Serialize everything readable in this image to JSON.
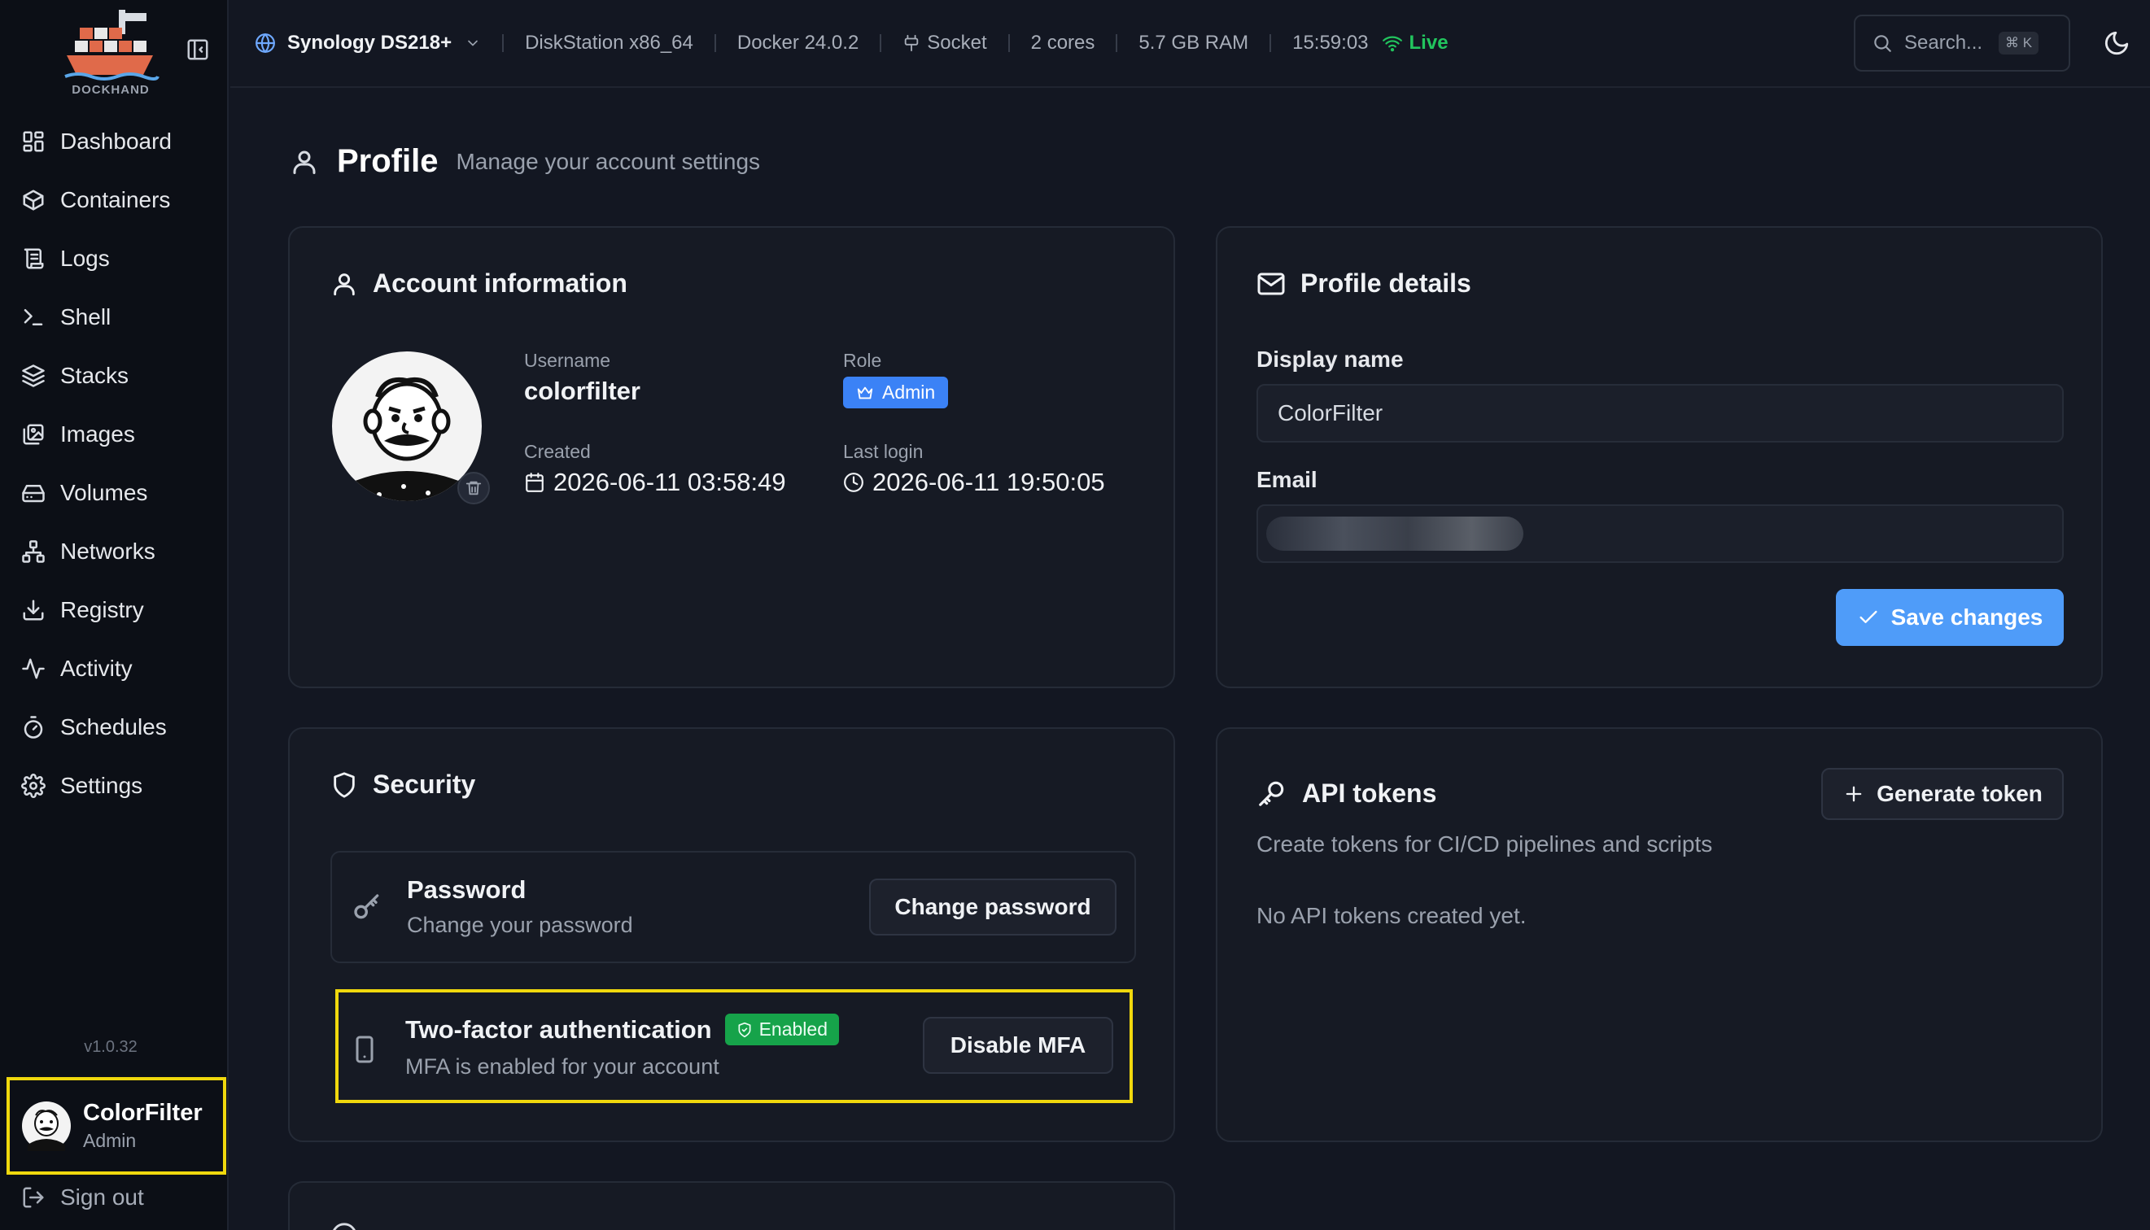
{
  "app": {
    "logo_text": "DOCKHAND",
    "version": "v1.0.32"
  },
  "sidebar": {
    "items": [
      {
        "label": "Dashboard",
        "icon": "dashboard-icon"
      },
      {
        "label": "Containers",
        "icon": "box-icon"
      },
      {
        "label": "Logs",
        "icon": "scroll-icon"
      },
      {
        "label": "Shell",
        "icon": "terminal-icon"
      },
      {
        "label": "Stacks",
        "icon": "layers-icon"
      },
      {
        "label": "Images",
        "icon": "images-icon"
      },
      {
        "label": "Volumes",
        "icon": "hard-drive-icon"
      },
      {
        "label": "Networks",
        "icon": "network-icon"
      },
      {
        "label": "Registry",
        "icon": "download-icon"
      },
      {
        "label": "Activity",
        "icon": "activity-icon"
      },
      {
        "label": "Schedules",
        "icon": "timer-icon"
      },
      {
        "label": "Settings",
        "icon": "gear-icon"
      }
    ],
    "user": {
      "name": "ColorFilter",
      "role": "Admin"
    },
    "signout_label": "Sign out"
  },
  "topbar": {
    "environment": "Synology DS218+",
    "host": "DiskStation x86_64",
    "docker": "Docker 24.0.2",
    "connection": "Socket",
    "cores": "2 cores",
    "ram": "5.7 GB RAM",
    "time": "15:59:03",
    "status": "Live",
    "search_placeholder": "Search...",
    "search_shortcut": "⌘ K"
  },
  "page": {
    "title": "Profile",
    "subtitle": "Manage your account settings"
  },
  "account": {
    "title": "Account information",
    "username_label": "Username",
    "username": "colorfilter",
    "role_label": "Role",
    "role": "Admin",
    "created_label": "Created",
    "created": "2026-06-11 03:58:49",
    "last_login_label": "Last login",
    "last_login": "2026-06-11 19:50:05"
  },
  "profile_details": {
    "title": "Profile details",
    "display_name_label": "Display name",
    "display_name": "ColorFilter",
    "email_label": "Email",
    "save_label": "Save changes"
  },
  "security": {
    "title": "Security",
    "password_title": "Password",
    "password_desc": "Change your password",
    "change_password_label": "Change password",
    "mfa_title": "Two-factor authentication",
    "mfa_badge": "Enabled",
    "mfa_desc": "MFA is enabled for your account",
    "disable_mfa_label": "Disable MFA"
  },
  "api_tokens": {
    "title": "API tokens",
    "generate_label": "Generate token",
    "description": "Create tokens for CI/CD pipelines and scripts",
    "empty_text": "No API tokens created yet."
  },
  "colors": {
    "accent": "#3b82f6",
    "live": "#22c55e",
    "enabled_badge": "#16a34a",
    "highlight": "#f0d80d"
  }
}
